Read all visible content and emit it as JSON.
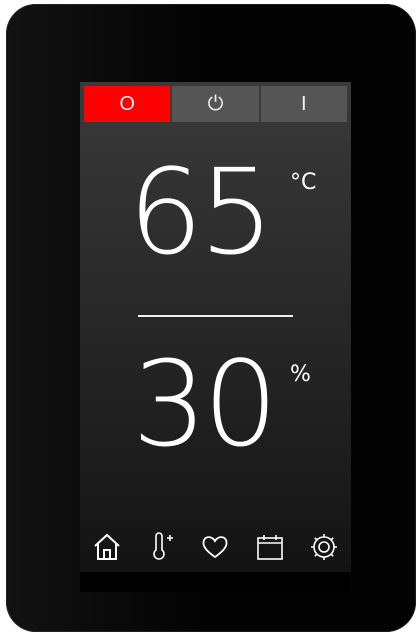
{
  "modes": [
    {
      "label": "O",
      "active": true
    },
    {
      "label": "⏻",
      "active": false
    },
    {
      "label": "I",
      "active": false
    }
  ],
  "temperature": {
    "value": "65",
    "unit": "°C"
  },
  "humidity": {
    "value": "30",
    "unit": "%"
  },
  "nav": [
    "home-icon",
    "thermometer-plus-icon",
    "heart-icon",
    "calendar-icon",
    "gear-icon"
  ],
  "colors": {
    "accent": "#ff0000",
    "mode_bg": "#555555",
    "device": "#030303"
  }
}
